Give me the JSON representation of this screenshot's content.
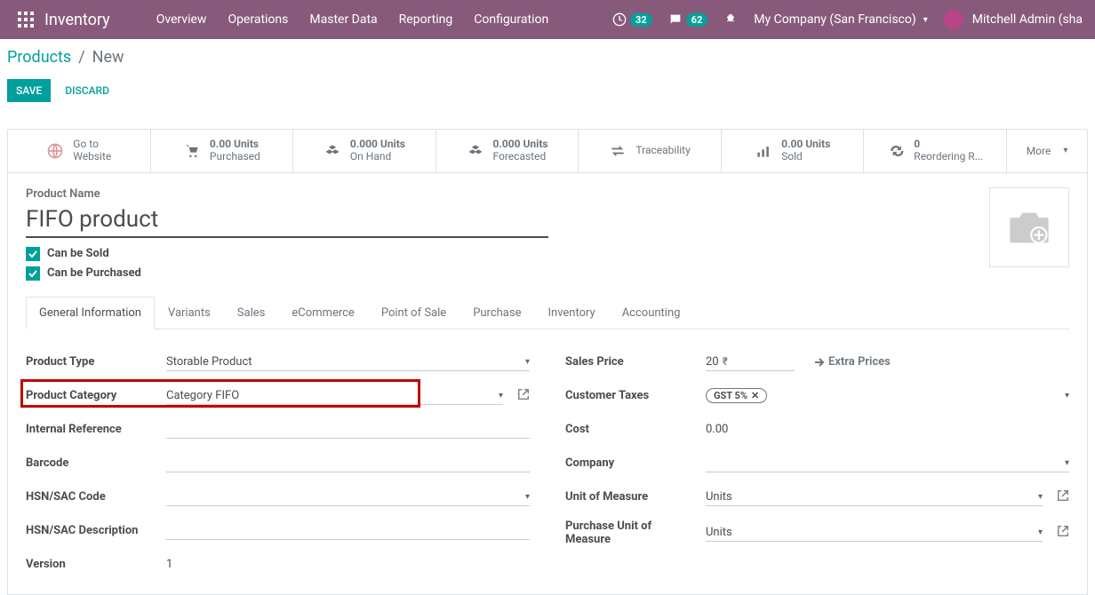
{
  "navbar": {
    "brand": "Inventory",
    "links": [
      "Overview",
      "Operations",
      "Master Data",
      "Reporting",
      "Configuration"
    ],
    "clock_badge": "32",
    "chat_badge": "62",
    "company": "My Company (San Francisco)",
    "user": "Mitchell Admin (sha"
  },
  "breadcrumb": {
    "root": "Products",
    "current": "New"
  },
  "actions": {
    "save": "SAVE",
    "discard": "DISCARD"
  },
  "stats": {
    "website": {
      "l1": "Go to",
      "l2": "Website"
    },
    "purchased": {
      "value": "0.00 Units",
      "label": "Purchased"
    },
    "onhand": {
      "value": "0.000 Units",
      "label": "On Hand"
    },
    "forecast": {
      "value": "0.000 Units",
      "label": "Forecasted"
    },
    "trace": {
      "label": "Traceability"
    },
    "sold": {
      "value": "0.00 Units",
      "label": "Sold"
    },
    "reorder": {
      "value": "0",
      "label": "Reordering R..."
    },
    "more": "More"
  },
  "product": {
    "name_label": "Product Name",
    "name": "FIFO product",
    "can_be_sold": "Can be Sold",
    "can_be_purchased": "Can be Purchased"
  },
  "tabs": [
    "General Information",
    "Variants",
    "Sales",
    "eCommerce",
    "Point of Sale",
    "Purchase",
    "Inventory",
    "Accounting"
  ],
  "left": {
    "product_type_l": "Product Type",
    "product_type_v": "Storable Product",
    "product_cat_l": "Product Category",
    "product_cat_v": "Category FIFO",
    "internal_ref_l": "Internal Reference",
    "internal_ref_v": "",
    "barcode_l": "Barcode",
    "barcode_v": "",
    "hsn_l": "HSN/SAC Code",
    "hsn_v": "",
    "hsn_desc_l": "HSN/SAC Description",
    "hsn_desc_v": "",
    "version_l": "Version",
    "version_v": "1"
  },
  "right": {
    "sales_price_l": "Sales Price",
    "sales_price_v": "20",
    "currency": "₹",
    "extra": "Extra Prices",
    "cust_tax_l": "Customer Taxes",
    "cust_tax_v": "GST 5%",
    "cost_l": "Cost",
    "cost_v": "0.00",
    "company_l": "Company",
    "company_v": "",
    "uom_l": "Unit of Measure",
    "uom_v": "Units",
    "puom_l": "Purchase Unit of Measure",
    "puom_v": "Units"
  }
}
